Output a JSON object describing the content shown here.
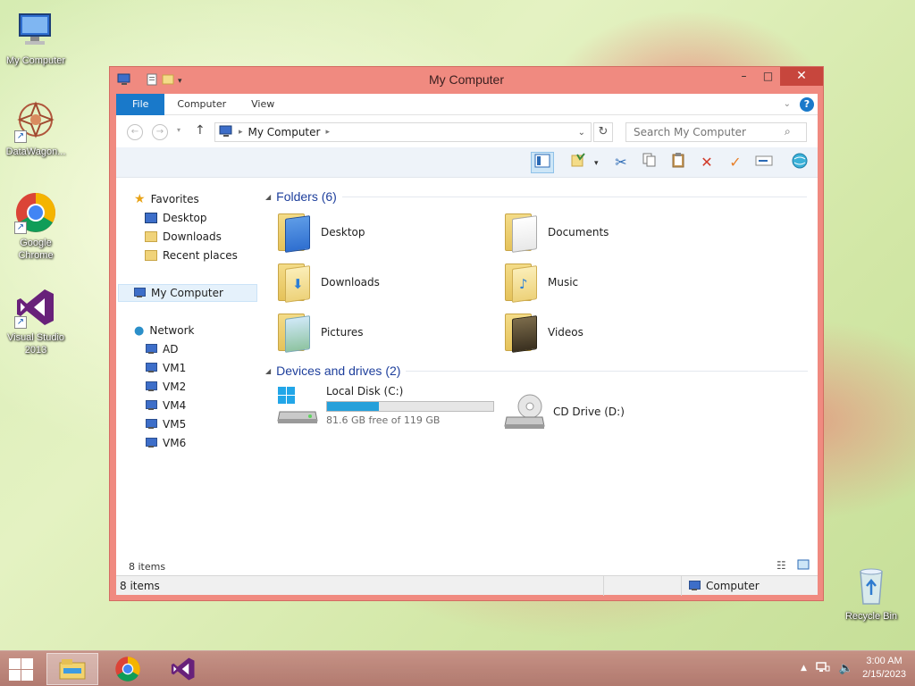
{
  "desktop": {
    "icons": [
      {
        "label": "My Computer"
      },
      {
        "label": "DataWagon..."
      },
      {
        "label": "Google Chrome"
      },
      {
        "label": "Visual Studio 2013"
      },
      {
        "label": "Recycle Bin"
      }
    ]
  },
  "window": {
    "title": "My Computer",
    "ribbon_tabs": [
      "File",
      "Computer",
      "View"
    ],
    "help_label": "?",
    "address": {
      "crumbs": [
        "My Computer"
      ]
    },
    "search_placeholder": "Search My Computer",
    "nav": {
      "favorites": {
        "label": "Favorites",
        "items": [
          "Desktop",
          "Downloads",
          "Recent places"
        ]
      },
      "computer": "My Computer",
      "network": {
        "label": "Network",
        "items": [
          "AD",
          "VM1",
          "VM2",
          "VM4",
          "VM5",
          "VM6"
        ]
      }
    },
    "groups": {
      "folders": {
        "title": "Folders (6)",
        "items": [
          "Desktop",
          "Documents",
          "Downloads",
          "Music",
          "Pictures",
          "Videos"
        ]
      },
      "devices": {
        "title": "Devices and drives (2)",
        "local_disk": {
          "label": "Local Disk (C:)",
          "free_text": "81.6 GB free of 119 GB",
          "used_fraction": 0.314
        },
        "cd_drive": {
          "label": "CD Drive (D:)"
        }
      }
    },
    "status": {
      "items_count": "8 items",
      "bar_left": "8 items",
      "bar_right": "Computer"
    }
  },
  "taskbar": {
    "clock_time": "3:00 AM",
    "clock_date": "2/15/2023"
  },
  "colors": {
    "accent": "#1979ca",
    "window_frame": "#f08a80",
    "close_button": "#c7463d",
    "progress_fill": "#26a0da"
  }
}
